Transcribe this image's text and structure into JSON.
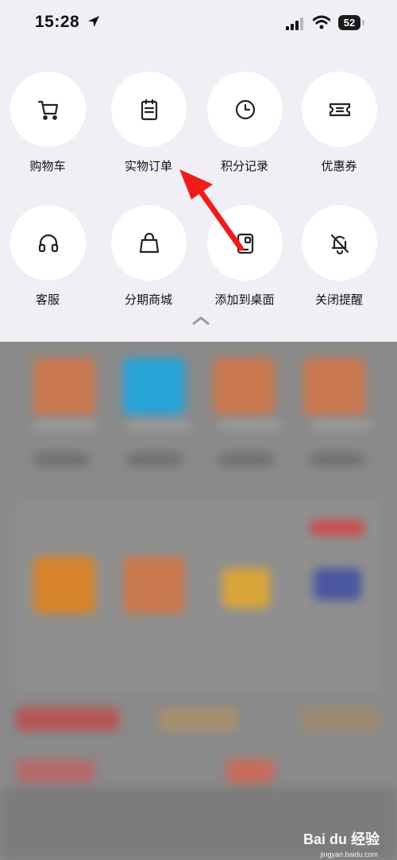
{
  "status_bar": {
    "time": "15:28",
    "battery": "52"
  },
  "menu": {
    "row1": [
      {
        "label": "购物车",
        "icon": "cart-icon"
      },
      {
        "label": "实物订单",
        "icon": "clipboard-icon"
      },
      {
        "label": "积分记录",
        "icon": "clock-icon"
      },
      {
        "label": "优惠券",
        "icon": "ticket-icon"
      }
    ],
    "row2": [
      {
        "label": "客服",
        "icon": "headphones-icon"
      },
      {
        "label": "分期商城",
        "icon": "bag-icon"
      },
      {
        "label": "添加到桌面",
        "icon": "add-to-desktop-icon"
      },
      {
        "label": "关闭提醒",
        "icon": "bell-off-icon"
      }
    ]
  },
  "annotation": {
    "arrow_color": "#f01c1c"
  },
  "watermark": {
    "text": "Bai du 经验",
    "sub": "jingyan.baidu.com"
  },
  "colors": {
    "panel_bg": "#f1eff5",
    "circle_bg": "#ffffff",
    "overlay": "#8a8a8a"
  }
}
